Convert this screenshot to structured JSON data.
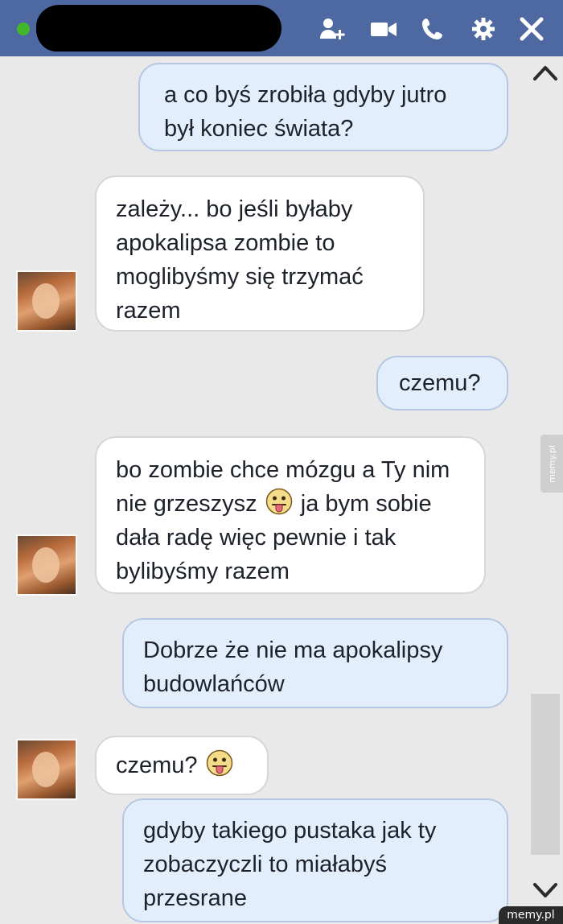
{
  "header": {
    "icons": [
      "add-people-icon",
      "video-call-icon",
      "phone-icon",
      "gear-icon",
      "close-icon"
    ],
    "colors": {
      "bar": "#4e69a2",
      "online": "#42b72a"
    }
  },
  "messages": [
    {
      "id": "m1",
      "direction": "sent",
      "text": "a co byś zrobiła gdyby jutro był koniec świata?"
    },
    {
      "id": "m2",
      "direction": "received",
      "text": "zależy... bo jeśli byłaby apokalipsa zombie to moglibyśmy się trzymać razem"
    },
    {
      "id": "m3",
      "direction": "sent",
      "text": "czemu?"
    },
    {
      "id": "m4",
      "direction": "received",
      "text_before": "bo zombie chce mózgu a Ty nim nie grzeszysz",
      "emoji": "tongue-out-emoji",
      "text_after": "ja bym sobie dała radę więc pewnie i tak bylibyśmy razem"
    },
    {
      "id": "m5",
      "direction": "sent",
      "text": "Dobrze że nie ma apokalipsy budowlańców"
    },
    {
      "id": "m6",
      "direction": "received",
      "text": "czemu?",
      "emoji": "tongue-out-emoji"
    },
    {
      "id": "m7",
      "direction": "sent",
      "text": "gdyby takiego pustaka  jak ty zobaczyczli to miałabyś przesrane"
    }
  ],
  "colors": {
    "sent_bubble": "#e3eefd",
    "received_bubble": "#ffffff",
    "background": "#e9e9e9"
  },
  "watermark": {
    "side": "memy.pl",
    "corner": "memy.pl"
  }
}
